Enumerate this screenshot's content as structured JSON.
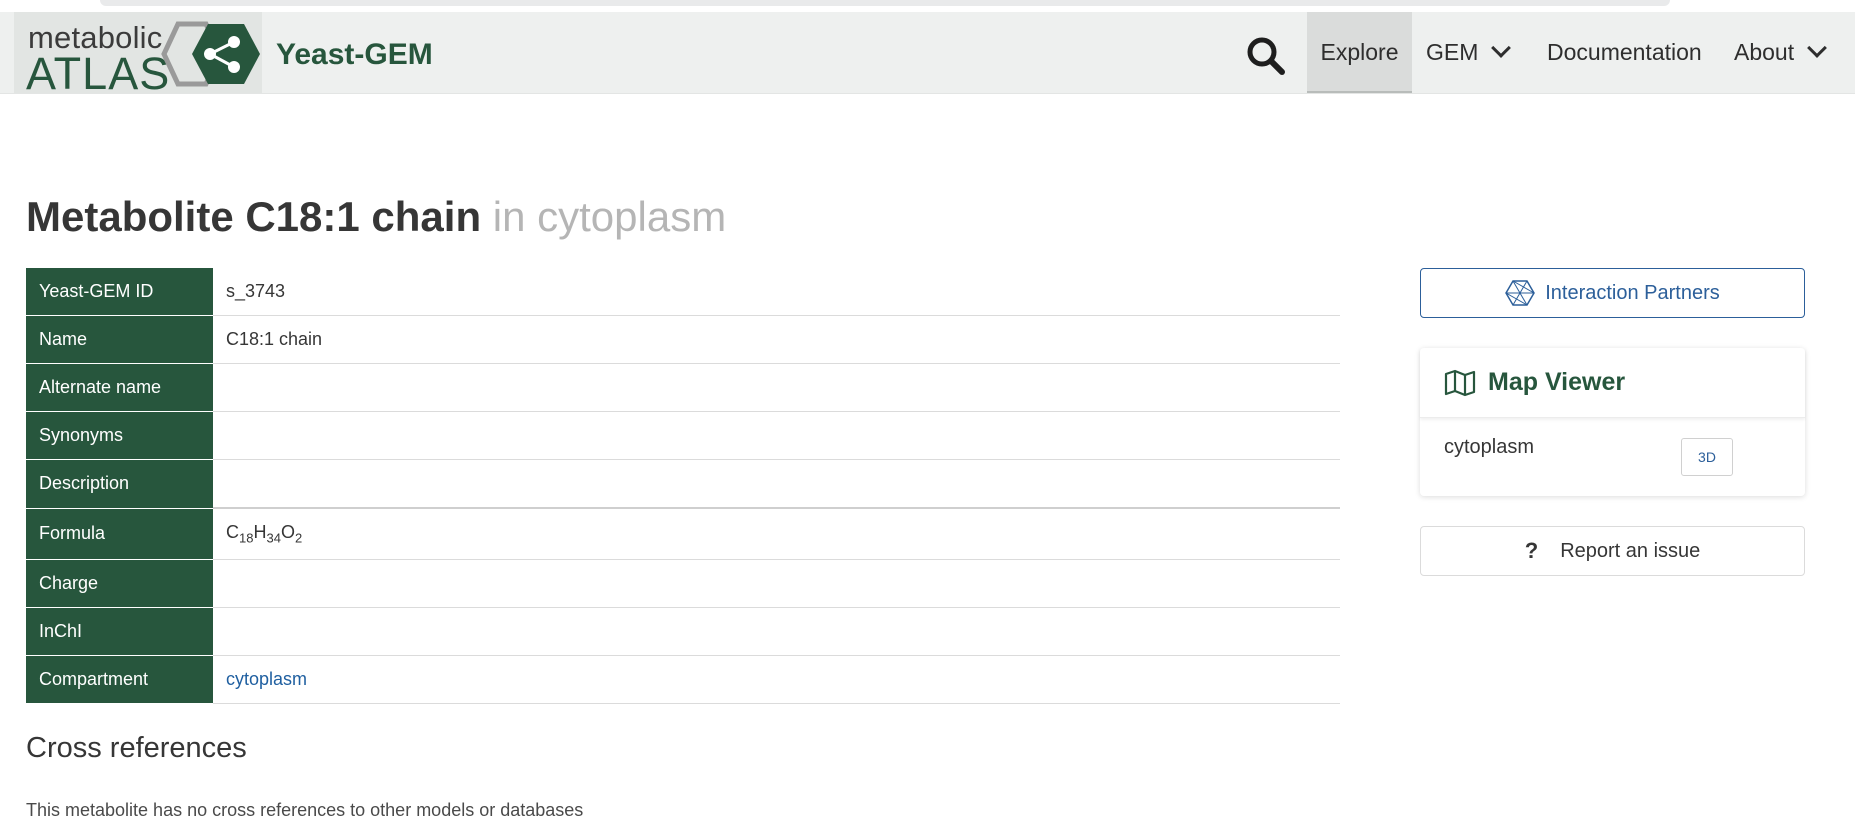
{
  "navbar": {
    "logo_line1": "metabolic",
    "logo_line2": "ATLAS",
    "model_name": "Yeast-GEM",
    "items": [
      {
        "label": "Explore"
      },
      {
        "label": "GEM"
      },
      {
        "label": "Documentation"
      },
      {
        "label": "About"
      }
    ]
  },
  "page": {
    "title_main": "Metabolite C18:1 chain",
    "title_sub": "in cytoplasm"
  },
  "info_table": [
    {
      "label": "Yeast-GEM ID",
      "value": "s_3743"
    },
    {
      "label": "Name",
      "value": "C18:1 chain"
    },
    {
      "label": "Alternate name",
      "value": ""
    },
    {
      "label": "Synonyms",
      "value": ""
    },
    {
      "label": "Description",
      "value": ""
    },
    {
      "label": "Formula",
      "value_parts": [
        "C",
        "18",
        "H",
        "34",
        "O",
        "2"
      ]
    },
    {
      "label": "Charge",
      "value": ""
    },
    {
      "label": "InChI",
      "value": ""
    },
    {
      "label": "Compartment",
      "value": "cytoplasm"
    }
  ],
  "cross_references": {
    "heading": "Cross references",
    "note": "This metabolite has no cross references to other models or databases"
  },
  "sidebar": {
    "interaction_partners_label": "Interaction Partners",
    "map_viewer": {
      "title": "Map Viewer",
      "compartment": "cytoplasm",
      "btn_3d": "3D"
    },
    "report_label": "Report an issue"
  },
  "colors": {
    "brand_green": "#27563d",
    "link_blue": "#1f5fa0",
    "navbar_bg": "#eef0ef"
  },
  "icons": [
    "search-icon",
    "chevron-down-icon",
    "interaction-network-icon",
    "map-icon",
    "question-icon",
    "share-hexagon-logo-icon"
  ]
}
